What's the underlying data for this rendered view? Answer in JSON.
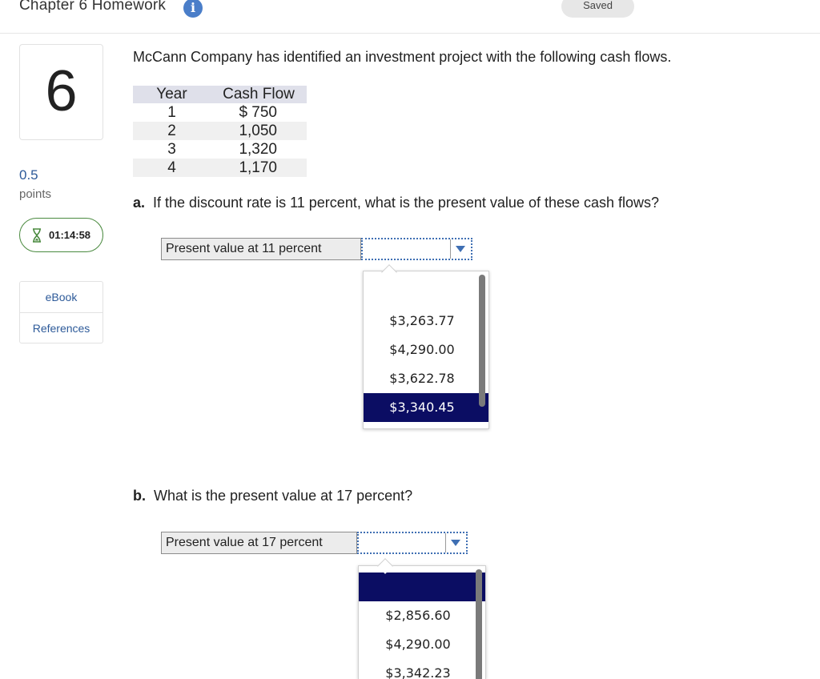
{
  "header": {
    "title": "Chapter 6 Homework",
    "info_icon": "i",
    "saved_label": "Saved"
  },
  "sidebar": {
    "question_number": "6",
    "points_value": "0.5",
    "points_label": "points",
    "timer": "01:14:58",
    "links": [
      "eBook",
      "References"
    ]
  },
  "main": {
    "intro": "McCann Company has identified an investment project with the following cash flows.",
    "table": {
      "headers": [
        "Year",
        "Cash Flow"
      ],
      "rows": [
        [
          "1",
          "$ 750"
        ],
        [
          "2",
          "1,050"
        ],
        [
          "3",
          "1,320"
        ],
        [
          "4",
          "1,170"
        ]
      ]
    },
    "part_a": {
      "letter": "a.",
      "question": "If the discount rate is 11 percent, what is the present value of these cash flows?",
      "answer_label": "Present value at 11 percent",
      "options": [
        "$3,263.77",
        "$4,290.00",
        "$3,622.78",
        "$3,340.45"
      ],
      "highlighted_option": "$3,340.45"
    },
    "part_b": {
      "letter": "b.",
      "question": "What is the present value at 17 percent?",
      "answer_label": "Present value at 17 percent",
      "options": [
        "",
        "$2,856.60",
        "$4,290.00",
        "$3,342.23"
      ],
      "highlighted_option": ""
    }
  },
  "colors": {
    "accent_blue": "#2d5a99",
    "highlight_navy": "#0b0d63",
    "timer_border": "#4a8a3f",
    "info_icon": "#4a7ec9"
  }
}
